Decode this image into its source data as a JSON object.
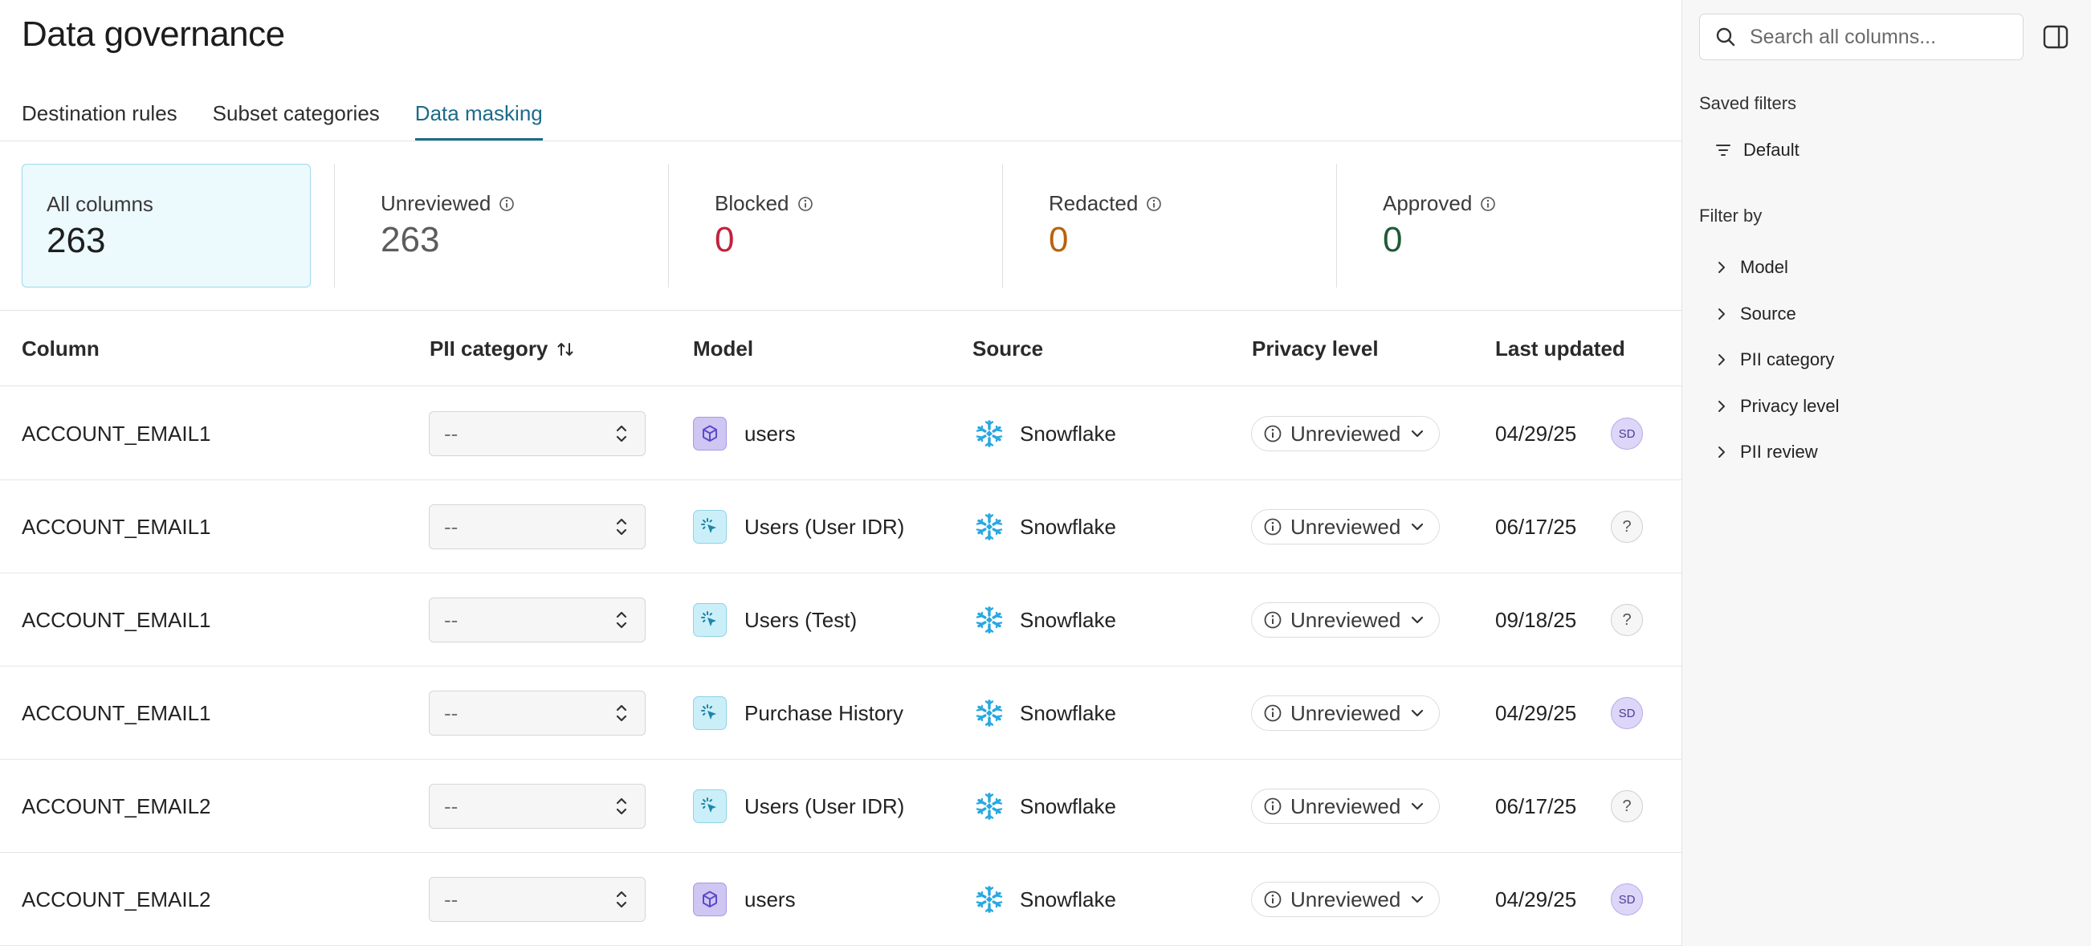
{
  "page": {
    "title": "Data governance"
  },
  "tabs": [
    {
      "label": "Destination rules"
    },
    {
      "label": "Subset categories"
    },
    {
      "label": "Data masking",
      "active": true
    }
  ],
  "stats": [
    {
      "label": "All columns",
      "value": "263",
      "color": "#1e1e1e"
    },
    {
      "label": "Unreviewed",
      "value": "263",
      "color": "#5c5c5c"
    },
    {
      "label": "Blocked",
      "value": "0",
      "color": "#c0223d"
    },
    {
      "label": "Redacted",
      "value": "0",
      "color": "#b8620f"
    },
    {
      "label": "Approved",
      "value": "0",
      "color": "#1f5b35"
    }
  ],
  "table": {
    "headers": {
      "column": "Column",
      "pii": "PII category",
      "model": "Model",
      "source": "Source",
      "privacy": "Privacy level",
      "updated": "Last updated"
    },
    "rows": [
      {
        "column": "ACCOUNT_EMAIL1",
        "pii": "--",
        "model": "users",
        "model_icon": "cube-icon",
        "source": "Snowflake",
        "privacy": "Unreviewed",
        "updated": "04/29/25",
        "avatar": "SD"
      },
      {
        "column": "ACCOUNT_EMAIL1",
        "pii": "--",
        "model": "Users (User IDR)",
        "model_icon": "cursor-click-icon",
        "source": "Snowflake",
        "privacy": "Unreviewed",
        "updated": "06/17/25",
        "avatar": "?"
      },
      {
        "column": "ACCOUNT_EMAIL1",
        "pii": "--",
        "model": "Users (Test)",
        "model_icon": "cursor-click-icon",
        "source": "Snowflake",
        "privacy": "Unreviewed",
        "updated": "09/18/25",
        "avatar": "?"
      },
      {
        "column": "ACCOUNT_EMAIL1",
        "pii": "--",
        "model": "Purchase History",
        "model_icon": "cursor-click-icon",
        "source": "Snowflake",
        "privacy": "Unreviewed",
        "updated": "04/29/25",
        "avatar": "SD"
      },
      {
        "column": "ACCOUNT_EMAIL2",
        "pii": "--",
        "model": "Users (User IDR)",
        "model_icon": "cursor-click-icon",
        "source": "Snowflake",
        "privacy": "Unreviewed",
        "updated": "06/17/25",
        "avatar": "?"
      },
      {
        "column": "ACCOUNT_EMAIL2",
        "pii": "--",
        "model": "users",
        "model_icon": "cube-icon",
        "source": "Snowflake",
        "privacy": "Unreviewed",
        "updated": "04/29/25",
        "avatar": "SD"
      }
    ]
  },
  "sidebar": {
    "search_placeholder": "Search all columns...",
    "saved_filters_heading": "Saved filters",
    "default_filter": "Default",
    "filter_by_heading": "Filter by",
    "filters": [
      {
        "label": "Model"
      },
      {
        "label": "Source"
      },
      {
        "label": "PII category"
      },
      {
        "label": "Privacy level"
      },
      {
        "label": "PII review"
      }
    ]
  },
  "colors": {
    "accent": "#1c6b8a",
    "snowflake": "#29a8e0"
  }
}
